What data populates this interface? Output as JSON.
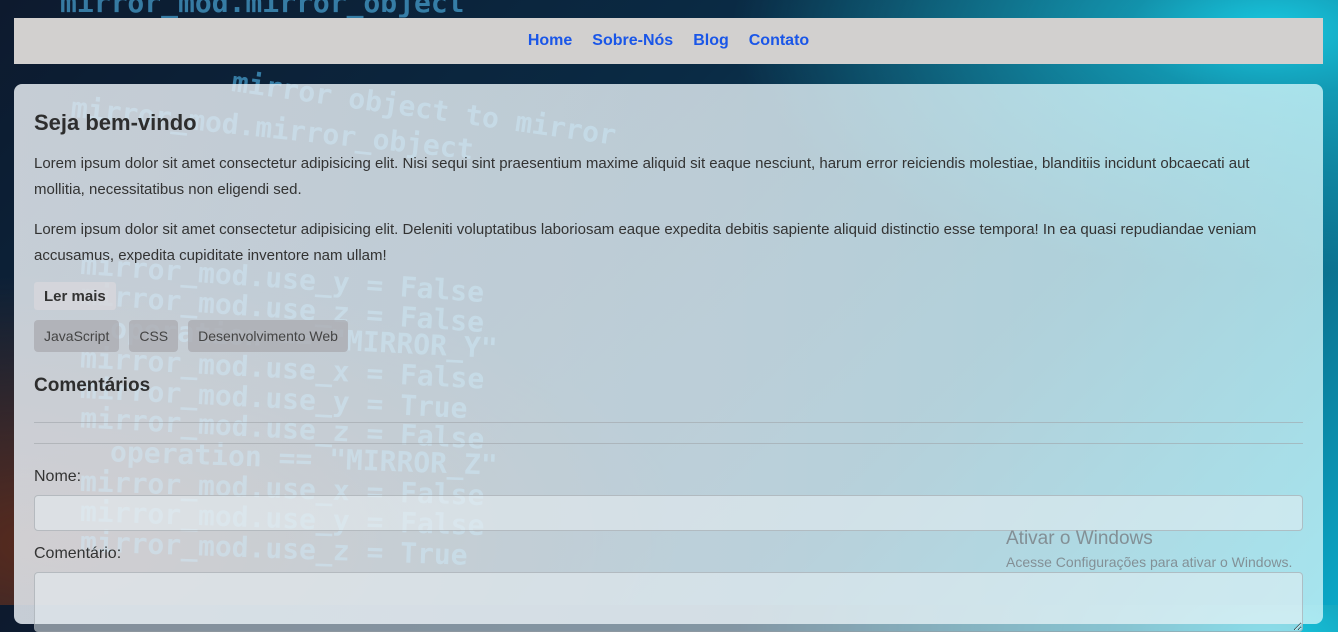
{
  "nav": {
    "items": [
      "Home",
      "Sobre-Nós",
      "Blog",
      "Contato"
    ]
  },
  "main": {
    "title": "Seja bem-vindo",
    "paragraph1": "Lorem ipsum dolor sit amet consectetur adipisicing elit. Nisi sequi sint praesentium maxime aliquid sit eaque nesciunt, harum error reiciendis molestiae, blanditiis incidunt obcaecati aut mollitia, necessitatibus non eligendi sed.",
    "paragraph2": "Lorem ipsum dolor sit amet consectetur adipisicing elit. Deleniti voluptatibus laboriosam eaque expedita debitis sapiente aliquid distinctio esse tempora! In ea quasi repudiandae veniam accusamus, expedita cupiditate inventore nam ullam!",
    "read_more": "Ler mais",
    "tags": [
      "JavaScript",
      "CSS",
      "Desenvolvimento Web"
    ]
  },
  "comments": {
    "title": "Comentários",
    "name_label": "Nome:",
    "comment_label": "Comentário:"
  },
  "watermark": {
    "line1": "Ativar o Windows",
    "line2": "Acesse Configurações para ativar o Windows."
  },
  "background_code": [
    "mirror_mod.mirror_object",
    "mirror object to mirror",
    "mirror_mod.mirror_object",
    "mirror_mod.use_y = False",
    "mirror_mod.use_z = False",
    "operation == \"MIRROR_Y\"",
    "mirror_mod.use_x = False",
    "mirror_mod.use_y = True",
    "mirror_mod.use_z = False",
    "operation == \"MIRROR_Z\"",
    "mirror_mod.use_x = False",
    "mirror_mod.use_y = False",
    "mirror_mod.use_z = True"
  ]
}
